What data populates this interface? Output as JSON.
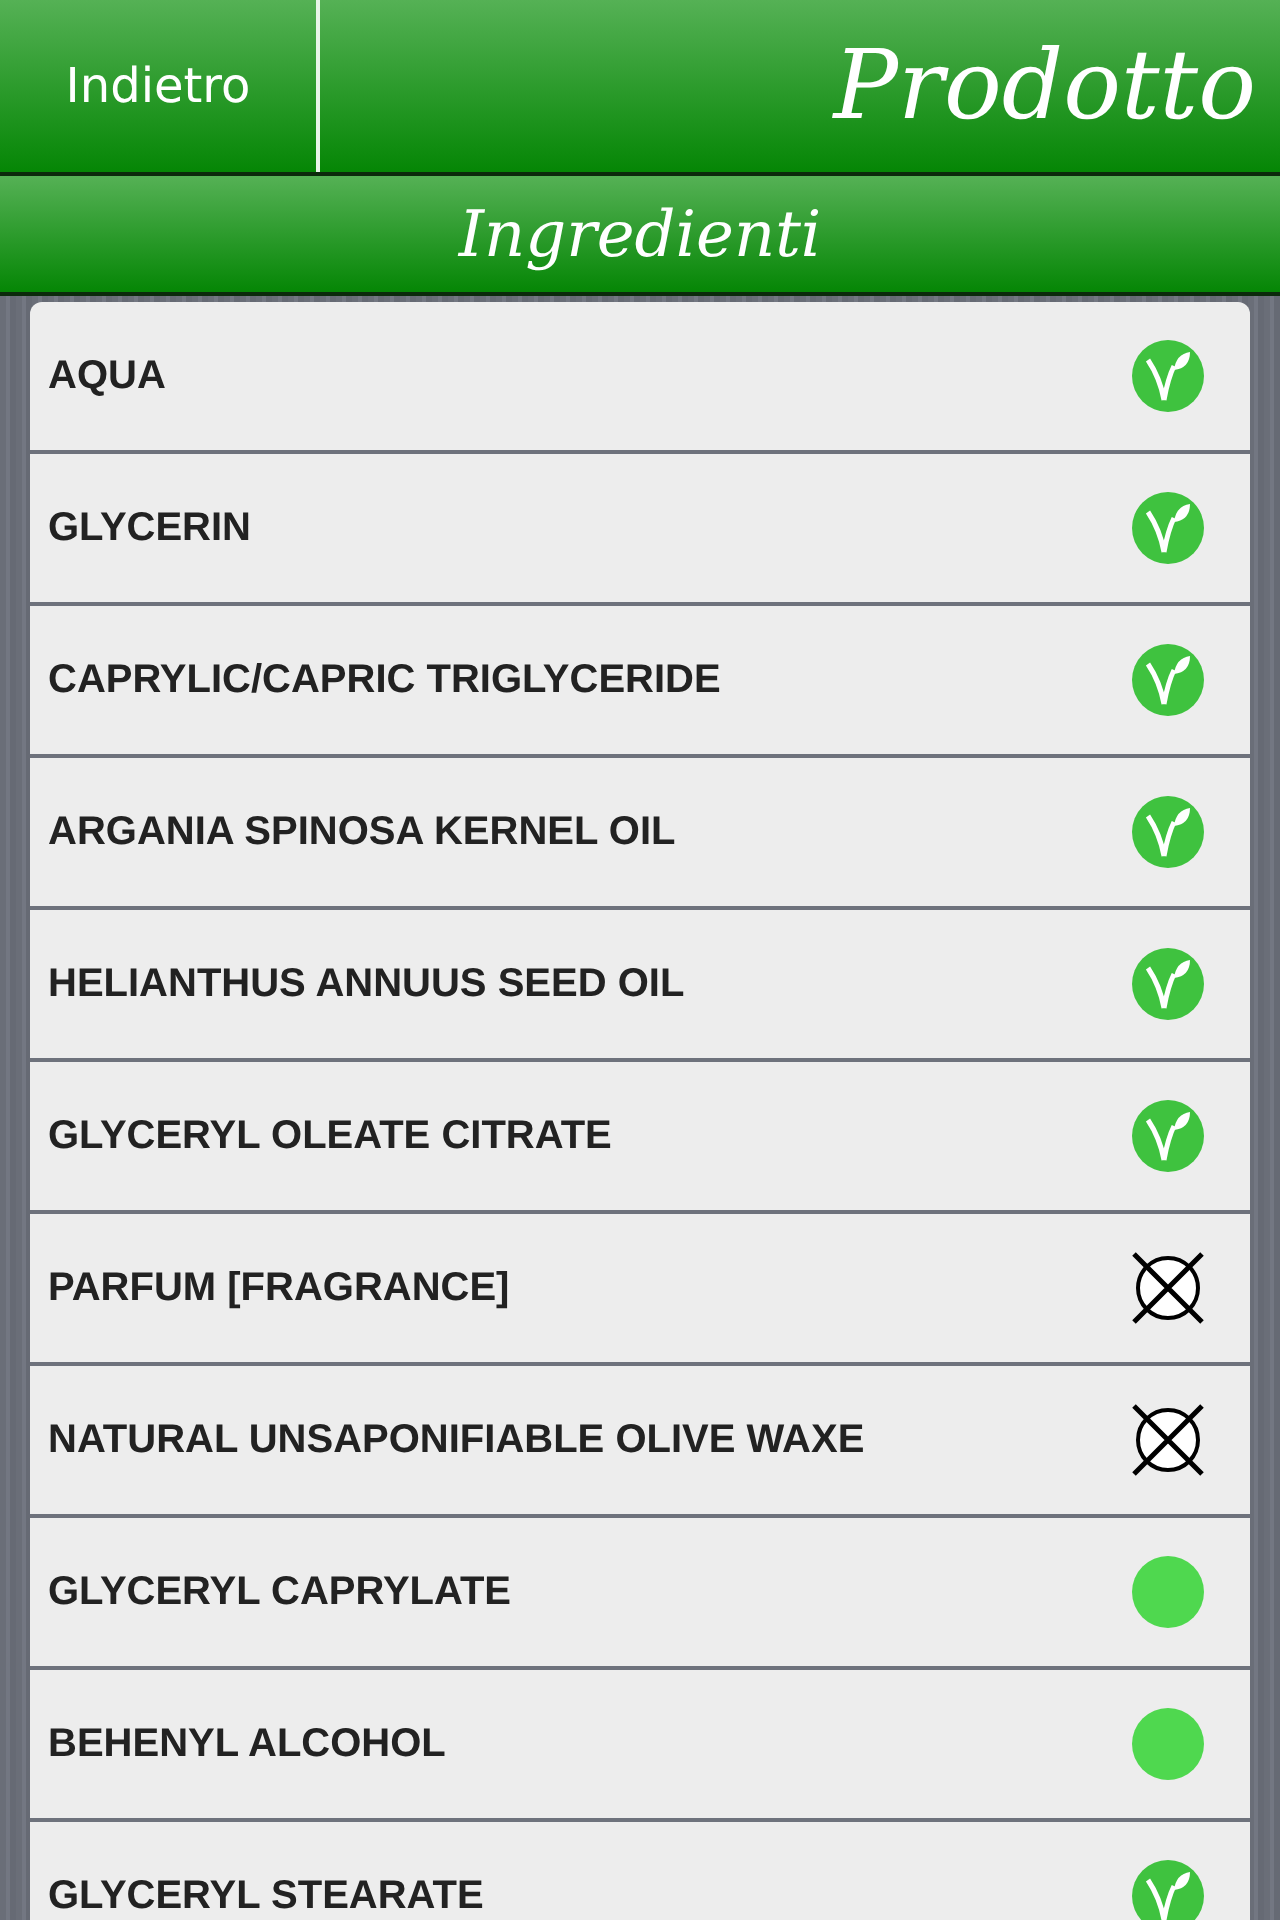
{
  "nav": {
    "back": "Indietro",
    "title": "Prodotto"
  },
  "section": "Ingredienti",
  "ingredients": [
    {
      "name": "AQUA",
      "kind": "vegan"
    },
    {
      "name": "GLYCERIN",
      "kind": "vegan"
    },
    {
      "name": "CAPRYLIC/CAPRIC TRIGLYCERIDE",
      "kind": "vegan"
    },
    {
      "name": "ARGANIA SPINOSA KERNEL OIL",
      "kind": "vegan"
    },
    {
      "name": "HELIANTHUS ANNUUS SEED OIL",
      "kind": "vegan"
    },
    {
      "name": "GLYCERYL OLEATE CITRATE",
      "kind": "vegan"
    },
    {
      "name": "PARFUM [FRAGRANCE]",
      "kind": "excluded"
    },
    {
      "name": "NATURAL UNSAPONIFIABLE OLIVE WAXE",
      "kind": "excluded"
    },
    {
      "name": "GLYCERYL CAPRYLATE",
      "kind": "dot"
    },
    {
      "name": "BEHENYL ALCOHOL",
      "kind": "dot"
    },
    {
      "name": "GLYCERYL STEARATE",
      "kind": "vegan"
    }
  ]
}
